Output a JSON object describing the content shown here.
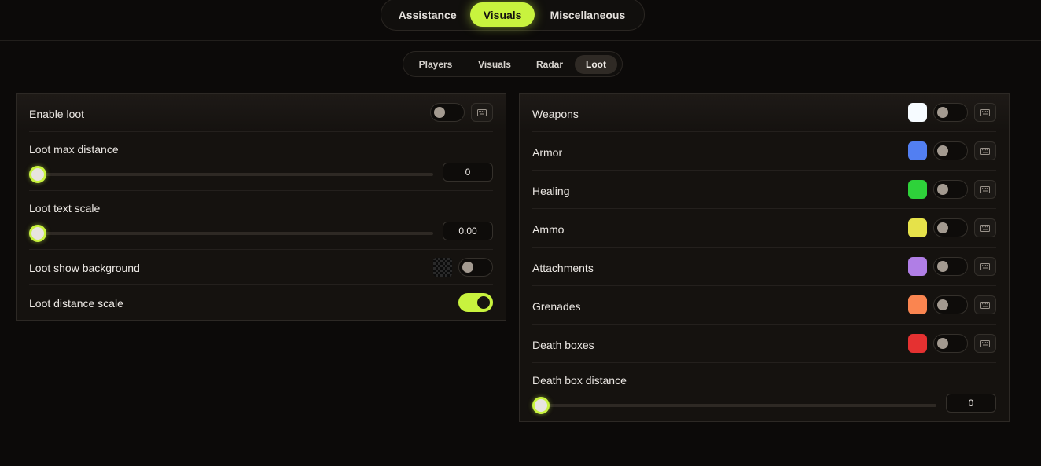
{
  "top_nav": {
    "tabs": [
      "Assistance",
      "Visuals",
      "Miscellaneous"
    ],
    "active": "Visuals"
  },
  "sub_nav": {
    "tabs": [
      "Players",
      "Visuals",
      "Radar",
      "Loot"
    ],
    "active": "Loot"
  },
  "left_panel": {
    "enable_loot": {
      "label": "Enable loot",
      "enabled": false
    },
    "loot_max_distance": {
      "label": "Loot max distance",
      "value": "0",
      "fraction": 0
    },
    "loot_text_scale": {
      "label": "Loot text scale",
      "value": "0.00",
      "fraction": 0
    },
    "loot_show_background": {
      "label": "Loot show background",
      "enabled": false
    },
    "loot_distance_scale": {
      "label": "Loot distance scale",
      "enabled": true
    }
  },
  "right_panel": {
    "items": [
      {
        "label": "Weapons",
        "color": "#f6fbff",
        "enabled": false
      },
      {
        "label": "Armor",
        "color": "#527ff2",
        "enabled": false
      },
      {
        "label": "Healing",
        "color": "#2ed23a",
        "enabled": false
      },
      {
        "label": "Ammo",
        "color": "#e6e24a",
        "enabled": false
      },
      {
        "label": "Attachments",
        "color": "#b07ee6",
        "enabled": false
      },
      {
        "label": "Grenades",
        "color": "#fa8550",
        "enabled": false
      },
      {
        "label": "Death boxes",
        "color": "#e53131",
        "enabled": false
      }
    ],
    "death_box_distance": {
      "label": "Death box distance",
      "value": "0",
      "fraction": 0
    }
  },
  "colors": {
    "accent": "#c8f33e",
    "background": "#0c0a09",
    "panel": "#15120f"
  },
  "icons": {
    "keybind": "keyboard-icon"
  }
}
